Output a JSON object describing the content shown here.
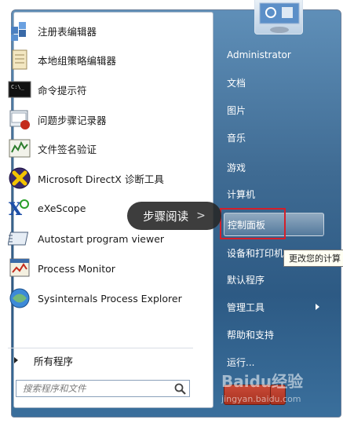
{
  "programs": [
    {
      "label": "注册表编辑器",
      "icon": "registry-editor-icon"
    },
    {
      "label": "本地组策略编辑器",
      "icon": "group-policy-icon"
    },
    {
      "label": "命令提示符",
      "icon": "command-prompt-icon"
    },
    {
      "label": "问题步骤记录器",
      "icon": "steps-recorder-icon"
    },
    {
      "label": "文件签名验证",
      "icon": "file-signature-icon"
    },
    {
      "label": "Microsoft DirectX 诊断工具",
      "icon": "directx-icon"
    },
    {
      "label": "eXeScope",
      "icon": "exescope-icon"
    },
    {
      "label": "Autostart program viewer",
      "icon": "autostart-icon"
    },
    {
      "label": "Process Monitor",
      "icon": "process-monitor-icon"
    },
    {
      "label": "Sysinternals Process Explorer",
      "icon": "process-explorer-icon"
    }
  ],
  "all_programs": "所有程序",
  "search": {
    "placeholder": "搜索程序和文件"
  },
  "right_items": [
    {
      "label": "Administrator"
    },
    {
      "label": "文档"
    },
    {
      "label": "图片"
    },
    {
      "label": "音乐"
    },
    {
      "label": "游戏"
    },
    {
      "label": "计算机"
    },
    {
      "label": "控制面板"
    },
    {
      "label": "设备和打印机"
    },
    {
      "label": "默认程序"
    },
    {
      "label": "管理工具"
    },
    {
      "label": "帮助和支持"
    },
    {
      "label": "运行..."
    }
  ],
  "tooltip": "更改您的计算",
  "bubble": {
    "label": "步骤阅读",
    "chevron": ">"
  },
  "watermark": {
    "brand": "Baidu经验",
    "url": "jingyan.baidu.com"
  },
  "colors": {
    "highlight_border": "#d41f2a",
    "menu_blue": "#3f6b93"
  }
}
